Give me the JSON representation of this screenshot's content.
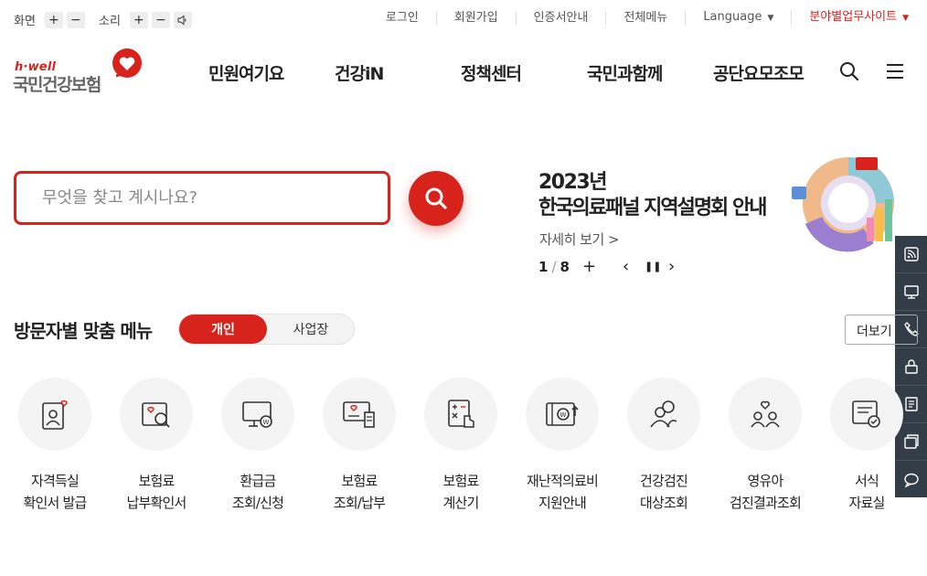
{
  "util": {
    "screen_label": "화면",
    "sound_label": "소리",
    "plus": "+",
    "minus": "−",
    "links": [
      "로그인",
      "회원가입",
      "인증서안내",
      "전체메뉴",
      "Language",
      "분야별업무사이트"
    ]
  },
  "logo": {
    "en": "h·well",
    "kr": "국민건강보험"
  },
  "nav": {
    "items": [
      "민원여기요",
      "건강iN",
      "정책센터",
      "국민과함께",
      "공단요모조모"
    ]
  },
  "search": {
    "placeholder": "무엇을 찾고 계시나요?"
  },
  "banner": {
    "year": "2023년",
    "title": "한국의료패널 지역설명회 안내",
    "more": "자세히 보기 >",
    "current": "1",
    "total": "8",
    "slash": "/",
    "plus": "+",
    "prev": "‹",
    "pause": "❚❚",
    "next": "›"
  },
  "visitor_menu": {
    "title": "방문자별 맞춤 메뉴",
    "tab_personal": "개인",
    "tab_business": "사업장",
    "more": "더보기",
    "items": [
      {
        "l1": "자격득실",
        "l2": "확인서 발급",
        "icon": "person-heart-doc-icon"
      },
      {
        "l1": "보험료",
        "l2": "납부확인서",
        "icon": "search-heart-doc-icon"
      },
      {
        "l1": "환급금",
        "l2": "조회/신청",
        "icon": "monitor-won-icon"
      },
      {
        "l1": "보험료",
        "l2": "조회/납부",
        "icon": "monitor-doc-icon"
      },
      {
        "l1": "보험료",
        "l2": "계산기",
        "icon": "calculator-hand-icon"
      },
      {
        "l1": "재난적의료비",
        "l2": "지원안내",
        "icon": "won-card-icon"
      },
      {
        "l1": "건강검진",
        "l2": "대상조회",
        "icon": "people-search-icon"
      },
      {
        "l1": "영유아",
        "l2": "검진결과조회",
        "icon": "family-heart-icon"
      },
      {
        "l1": "서식",
        "l2": "자료실",
        "icon": "doc-check-icon"
      }
    ]
  },
  "quick_icons": [
    "rss-icon",
    "remote-support-icon",
    "phone-icon",
    "lock-icon",
    "notice-icon",
    "window-icon",
    "chat-icon"
  ],
  "colors": {
    "accent": "#d8231d",
    "sidebar": "#333d48",
    "circle_bg": "#f4f4f4"
  }
}
